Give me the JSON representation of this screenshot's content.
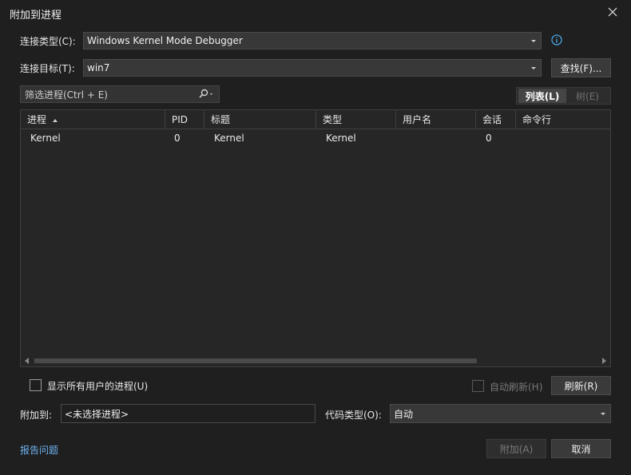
{
  "window": {
    "title": "附加到进程",
    "close_icon": "close-icon"
  },
  "connection_type": {
    "label": "连接类型(C):",
    "value": "Windows Kernel Mode Debugger",
    "info_icon": "info-icon"
  },
  "connection_target": {
    "label": "连接目标(T):",
    "value": "win7",
    "find_button": "查找(F)..."
  },
  "filter": {
    "placeholder": "筛选进程(Ctrl + E)",
    "icon": "search-icon"
  },
  "view_toggle": {
    "list": "列表(L)",
    "tree": "树(E)"
  },
  "table": {
    "columns": [
      "进程",
      "PID",
      "标题",
      "类型",
      "用户名",
      "会话",
      "命令行"
    ],
    "rows": [
      {
        "process": "Kernel",
        "pid": "0",
        "title": "Kernel",
        "type": "Kernel",
        "user": "",
        "session": "0",
        "cmd": ""
      }
    ]
  },
  "options": {
    "show_all_users": "显示所有用户的进程(U)",
    "auto_refresh": "自动刷新(H)",
    "refresh_button": "刷新(R)"
  },
  "attach_to": {
    "label": "附加到:",
    "value": "<未选择进程>"
  },
  "code_type": {
    "label": "代码类型(O):",
    "value": "自动"
  },
  "footer": {
    "report_link": "报告问题",
    "attach_button": "附加(A)",
    "cancel_button": "取消"
  },
  "colors": {
    "background": "#1f1f1f",
    "accent_link": "#6fb3f0",
    "info_icon": "#4aa3e0"
  }
}
